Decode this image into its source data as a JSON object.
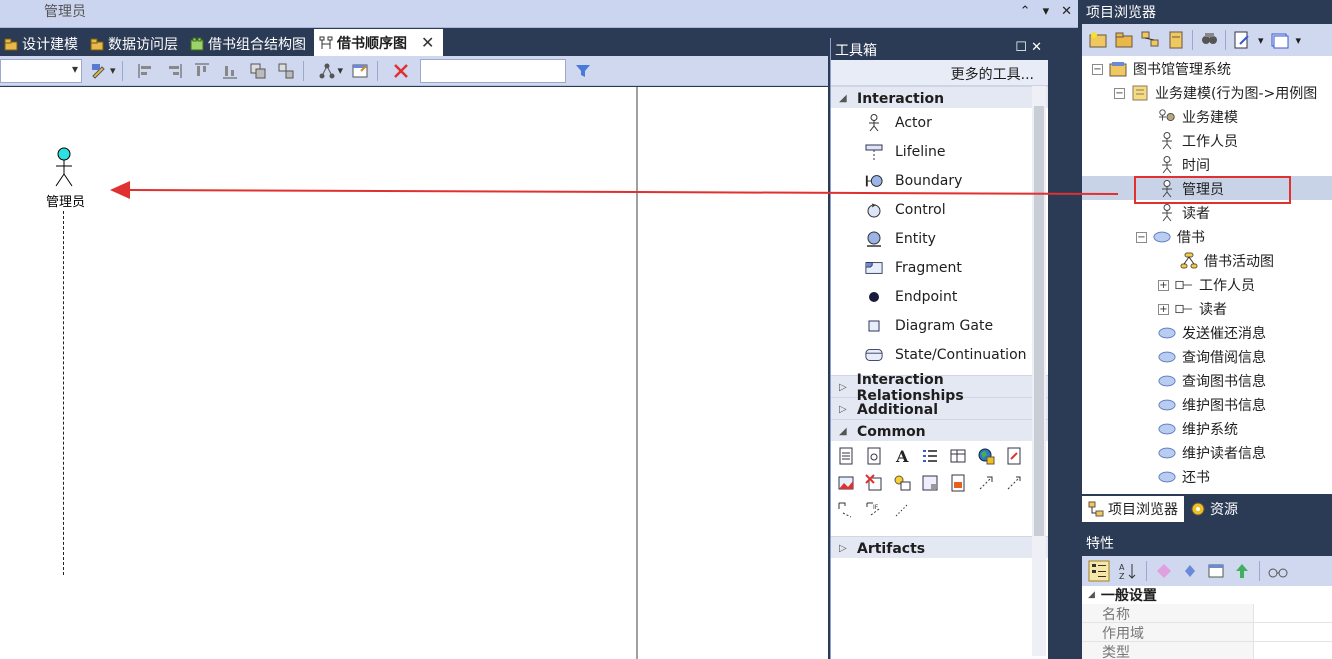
{
  "top": {
    "title": "管理员"
  },
  "tabs": [
    {
      "label": "设计建模",
      "active": false
    },
    {
      "label": "数据访问层",
      "active": false
    },
    {
      "label": "借书组合结构图",
      "active": false
    },
    {
      "label": "借书顺序图",
      "active": true
    }
  ],
  "canvas": {
    "actor_label": "管理员"
  },
  "toolbox": {
    "title": "工具箱",
    "more_tools": "更多的工具...",
    "sections": {
      "interaction": "Interaction",
      "interaction_relationships": "Interaction Relationships",
      "additional": "Additional",
      "common": "Common",
      "artifacts": "Artifacts"
    },
    "items": [
      "Actor",
      "Lifeline",
      "Boundary",
      "Control",
      "Entity",
      "Fragment",
      "Endpoint",
      "Diagram Gate",
      "State/Continuation"
    ]
  },
  "project_browser": {
    "title": "项目浏览器",
    "root": "图书馆管理系统",
    "package": "业务建模(行为图->用例图",
    "nodes": [
      "业务建模",
      "工作人员",
      "时间",
      "管理员",
      "读者",
      "借书",
      "借书活动图",
      "工作人员",
      "读者",
      "发送催还消息",
      "查询借阅信息",
      "查询图书信息",
      "维护图书信息",
      "维护系统",
      "维护读者信息",
      "还书"
    ],
    "tabs": {
      "browser": "项目浏览器",
      "resources": "资源"
    }
  },
  "properties": {
    "title": "特性",
    "group": "一般设置",
    "rows": [
      "名称",
      "作用域",
      "类型"
    ]
  },
  "colors": {
    "accent_red": "#e03030",
    "dock_bg": "#2b3a55",
    "toolbar_bg": "#cfd8ef"
  }
}
